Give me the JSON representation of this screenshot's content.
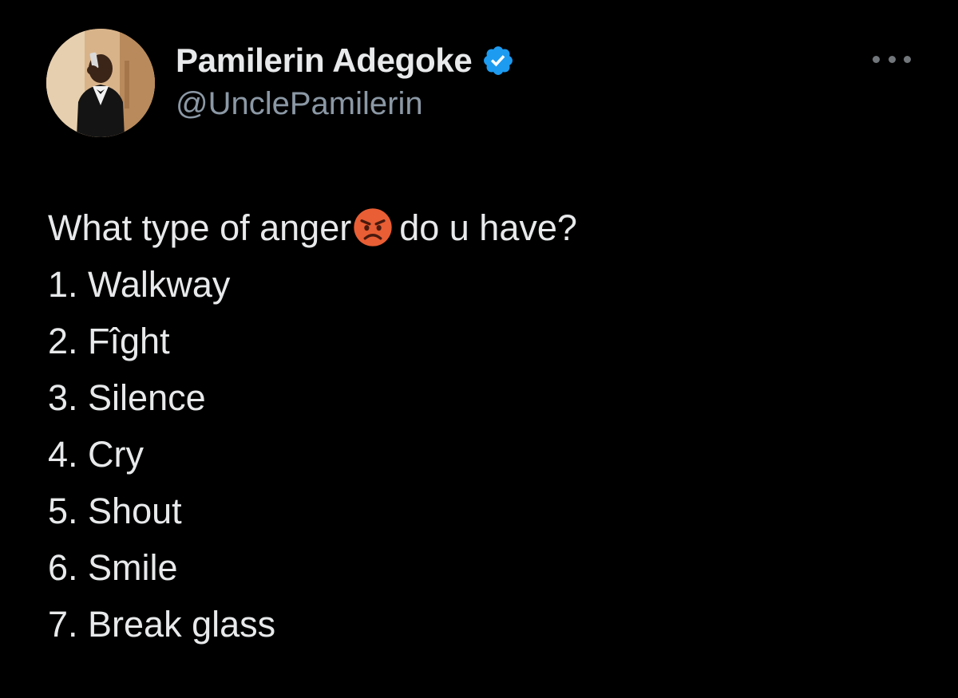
{
  "tweet": {
    "author": {
      "display_name": "Pamilerin Adegoke",
      "handle": "@UnclePamilerin",
      "verified": true,
      "verified_color": "#1d9bf0"
    },
    "more_icon": "more-horizontal-icon",
    "text": {
      "question_before_emoji": "What type of anger",
      "emoji": "angry-face",
      "question_after_emoji": "do u have?",
      "options": [
        "1. Walkway",
        "2. Fîght",
        "3. Silence",
        "4. Cry",
        "5. Shout",
        "6. Smile",
        "7. Break glass"
      ]
    }
  },
  "theme": {
    "background": "#000000",
    "text_primary": "#e7e9ea",
    "text_secondary": "#8b98a5"
  }
}
